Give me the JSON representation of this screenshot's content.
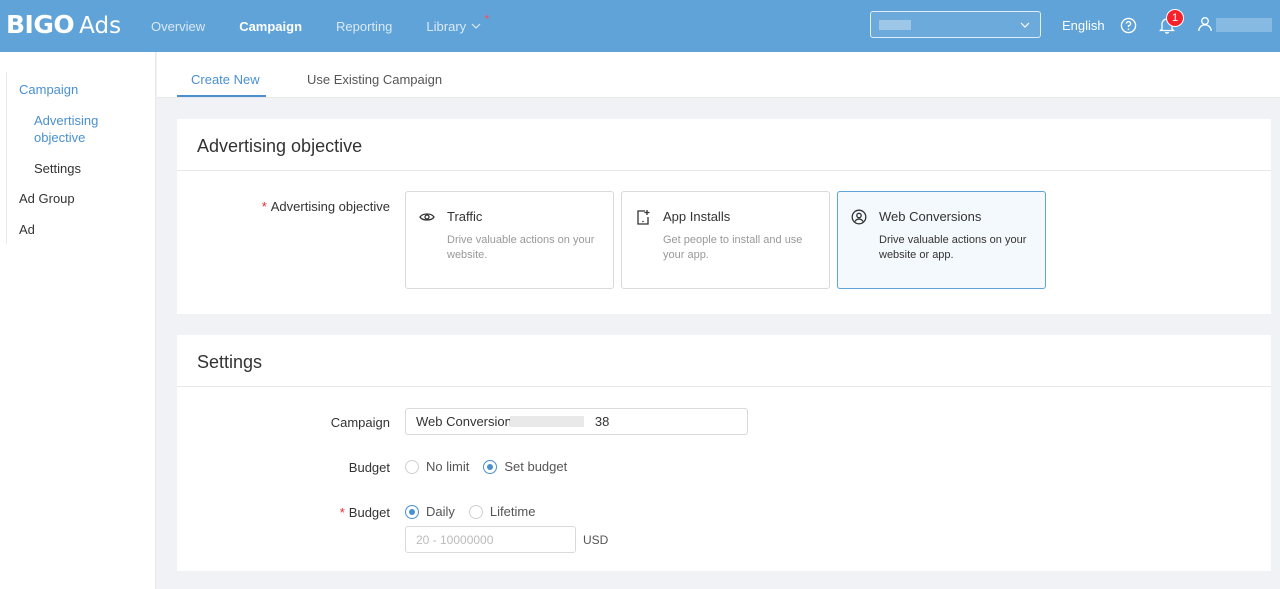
{
  "header": {
    "logo_brand": "BIGO",
    "logo_product": "Ads",
    "nav": [
      {
        "label": "Overview"
      },
      {
        "label": "Campaign"
      },
      {
        "label": "Reporting"
      },
      {
        "label": "Library"
      }
    ],
    "library_dot": "*",
    "language": "English",
    "notification_count": "1"
  },
  "sidebar": {
    "items": [
      {
        "label": "Campaign"
      },
      {
        "label": "Advertising objective"
      },
      {
        "label": "Settings"
      },
      {
        "label": "Ad Group"
      },
      {
        "label": "Ad"
      }
    ]
  },
  "tabs": [
    {
      "label": "Create New"
    },
    {
      "label": "Use Existing Campaign"
    }
  ],
  "objective_section": {
    "title": "Advertising objective",
    "field_label": "Advertising objective",
    "options": [
      {
        "title": "Traffic",
        "desc": "Drive valuable actions on your website.",
        "icon": "eye-icon"
      },
      {
        "title": "App Installs",
        "desc": "Get people to install and use your app.",
        "icon": "app-install-icon"
      },
      {
        "title": "Web Conversions",
        "desc": "Drive valuable actions on your website or app.",
        "icon": "user-circle-icon"
      }
    ]
  },
  "settings_section": {
    "title": "Settings",
    "campaign_label": "Campaign",
    "campaign_value": "Web Conversions-                    38",
    "budget_type_label": "Budget",
    "budget_type_options": [
      "No limit",
      "Set budget"
    ],
    "budget_label": "Budget",
    "budget_period_options": [
      "Daily",
      "Lifetime"
    ],
    "budget_placeholder": "20 - 10000000",
    "currency": "USD"
  },
  "colors": {
    "header_bg": "#5fa3d8",
    "accent": "#4a90d0",
    "required": "#f5222d"
  }
}
